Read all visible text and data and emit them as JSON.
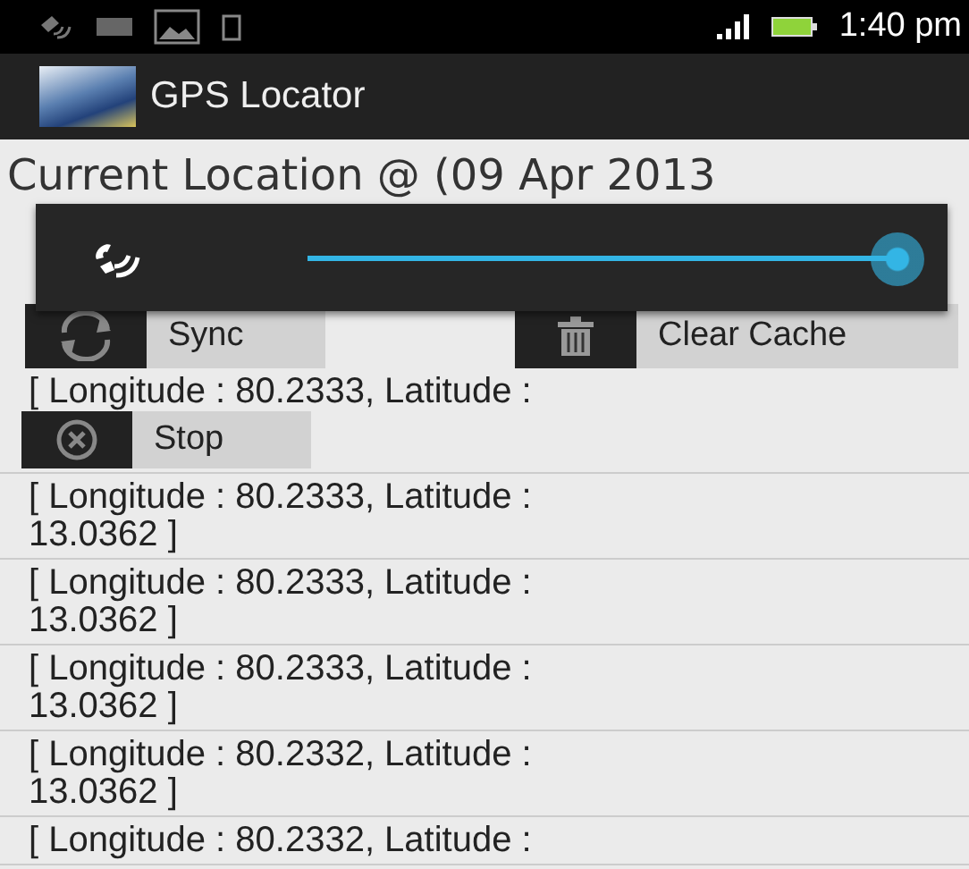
{
  "status_bar": {
    "time": "1:40 pm"
  },
  "action_bar": {
    "title": "GPS Locator"
  },
  "heading": "Current Location @ (09 Apr 2013",
  "volume_popup": {
    "level": 1.0
  },
  "buttons": [
    {
      "kind": "sync",
      "label": "Sync"
    },
    {
      "kind": "clear",
      "label": "Clear Cache"
    }
  ],
  "locations": [
    {
      "line1": "[ Longitude : 80.2333, Latitude :",
      "stop_button": "Stop"
    },
    {
      "line1": "[ Longitude : 80.2333, Latitude :",
      "line2": "13.0362 ]"
    },
    {
      "line1": "[ Longitude : 80.2333, Latitude :",
      "line2": "13.0362 ]"
    },
    {
      "line1": "[ Longitude : 80.2333, Latitude :",
      "line2": "13.0362 ]"
    },
    {
      "line1": "[ Longitude : 80.2332, Latitude :",
      "line2": "13.0362 ]"
    },
    {
      "line1": "[ Longitude : 80.2332, Latitude :"
    }
  ]
}
